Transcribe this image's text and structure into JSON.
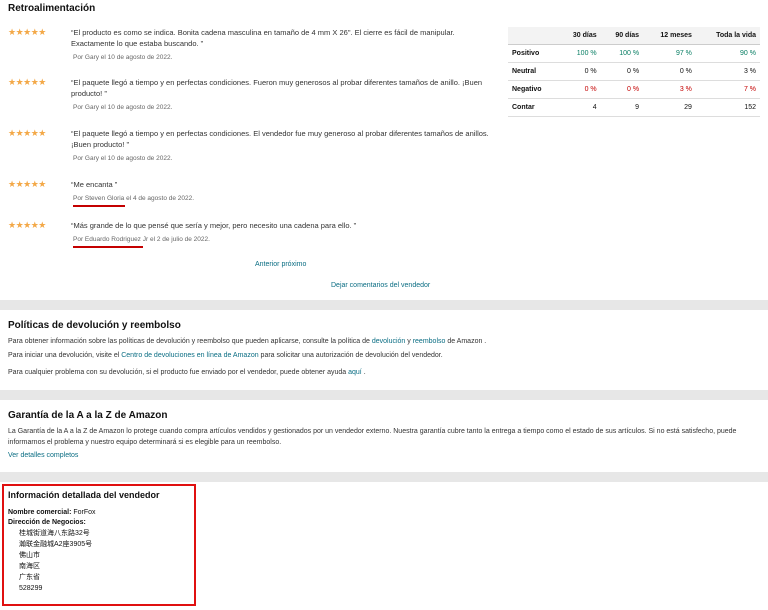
{
  "feedback": {
    "title": "Retroalimentación",
    "stars": "★★★★★",
    "reviews": [
      {
        "text": "“El producto es como se indica. Bonita cadena masculina en tamaño de 4 mm X 26\". El cierre es fácil de manipular. Exactamente lo que estaba buscando. ”",
        "by": "Por Gary el 10 de agosto de 2022."
      },
      {
        "text": "“El paquete llegó a tiempo y en perfectas condiciones. Fueron muy generosos al probar diferentes tamaños de anillo. ¡Buen producto! ”",
        "by": "Por Gary el 10 de agosto de 2022."
      },
      {
        "text": "“El paquete llegó a tiempo y en perfectas condiciones. El vendedor fue muy generoso al probar diferentes tamaños de anillos. ¡Buen producto! ”",
        "by": "Por Gary el 10 de agosto de 2022."
      },
      {
        "text": "“Me encanta ”",
        "by": "Por Steven Gloria el 4 de agosto de 2022."
      },
      {
        "text": "“Más grande de lo que pensé que sería y mejor, pero necesito una cadena para ello. ”",
        "by": "Por Eduardo Rodriguez Jr el 2 de julio de 2022."
      }
    ],
    "pagination": "Anterior próximo",
    "leave_feedback": "Dejar comentarios del vendedor"
  },
  "stats": {
    "headers": [
      "",
      "30 días",
      "90 días",
      "12 meses",
      "Toda la vida"
    ],
    "rows": [
      {
        "label": "Positivo",
        "values": [
          "100 %",
          "100 %",
          "97 %",
          "90 %"
        ]
      },
      {
        "label": "Neutral",
        "values": [
          "0 %",
          "0 %",
          "0 %",
          "3 %"
        ]
      },
      {
        "label": "Negativo",
        "values": [
          "0 %",
          "0 %",
          "3 %",
          "7 %"
        ]
      },
      {
        "label": "Contar",
        "values": [
          "4",
          "9",
          "29",
          "152"
        ]
      }
    ],
    "colors": {
      "positive": "#067d62",
      "negative": "#c40000"
    }
  },
  "returns": {
    "title": "Políticas de devolución y reembolso",
    "p1_pre": "Para obtener información sobre las políticas de devolución y reembolso que pueden aplicarse, consulte la política de ",
    "p1_link1": "devolución",
    "p1_mid": " y ",
    "p1_link2": "reembolso",
    "p1_post": " de Amazon .",
    "p2_pre": "Para iniciar una devolución, visite el ",
    "p2_link": "Centro de devoluciones en línea de Amazon",
    "p2_post": " para solicitar una autorización de devolución del vendedor.",
    "p3_pre": "Para cualquier problema con su devolución, si el producto fue enviado por el vendedor, puede obtener ayuda ",
    "p3_link": "aquí",
    "p3_post": " ."
  },
  "guarantee": {
    "title": "Garantía de la A a la Z de Amazon",
    "text": "La Garantía de la A a la Z de Amazon lo protege cuando compra artículos vendidos y gestionados por un vendedor externo. Nuestra garantía cubre tanto la entrega a tiempo como el estado de sus artículos. Si no está satisfecho, puede informarnos el problema y nuestro equipo determinará si es elegible para un reembolso.",
    "link": "Ver detalles completos"
  },
  "seller": {
    "title": "Información detallada del vendedor",
    "name_label": "Nombre comercial:",
    "name_value": "ForFox",
    "address_label": "Dirección de Negocios:",
    "address_lines": [
      "桂城街道海八东路32号",
      "瀚联金融城A2座3905号",
      "佛山市",
      "南海区",
      "广东省",
      "528299"
    ]
  }
}
